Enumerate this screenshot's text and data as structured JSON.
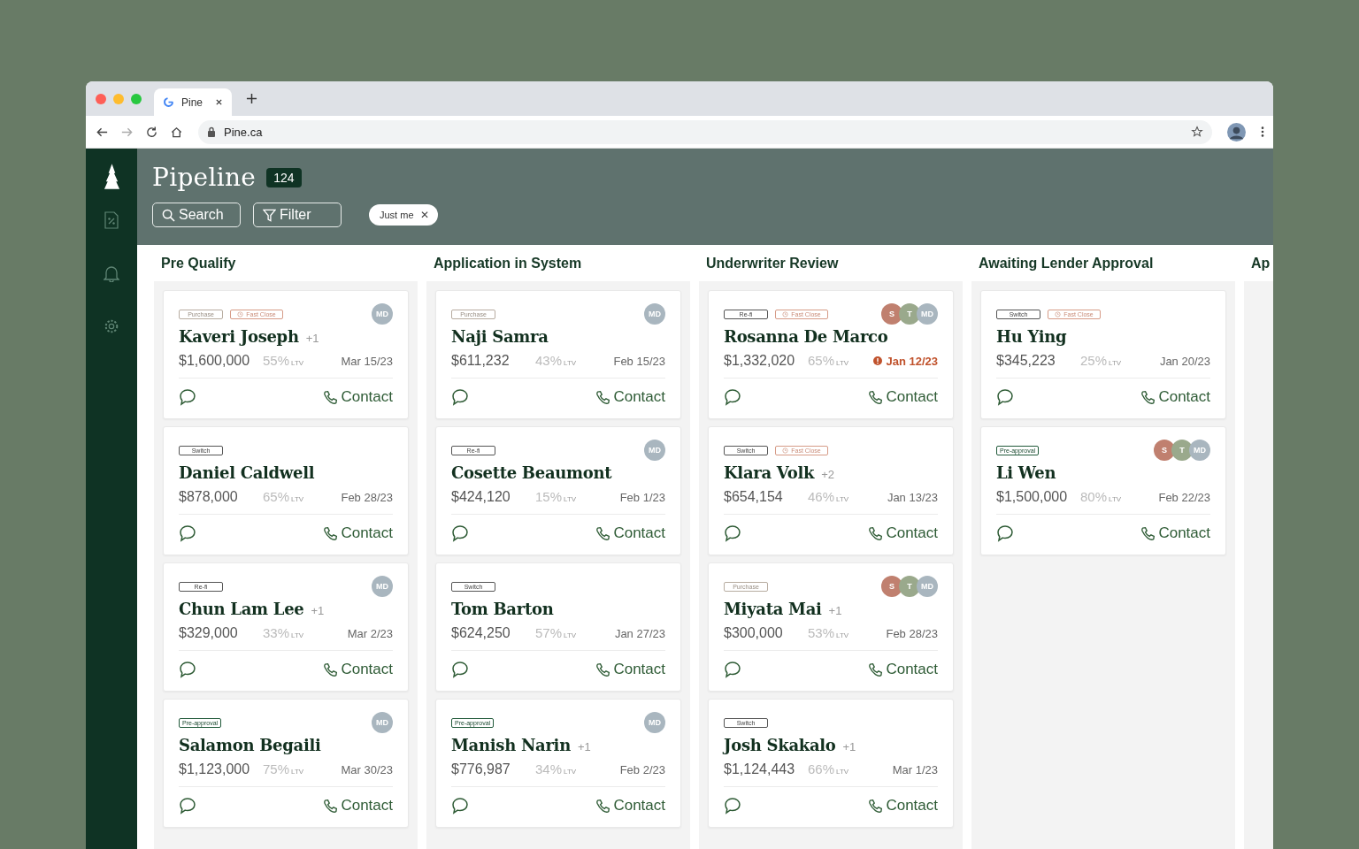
{
  "browser": {
    "tab_title": "Pine",
    "url": "Pine.ca"
  },
  "header": {
    "title": "Pipeline",
    "count": "124",
    "search_label": "Search",
    "filter_label": "Filter",
    "chip": {
      "label": "Just me",
      "close": "✕"
    }
  },
  "columns": [
    {
      "title": "Pre Qualify",
      "cards": [
        {
          "tags": [
            {
              "label": "Purchase",
              "kind": "purchase"
            },
            {
              "label": "Fast Close",
              "kind": "fast"
            }
          ],
          "name": "Kaveri Joseph",
          "extra": "+1",
          "avatars": [
            {
              "initials": "MD",
              "color": "#a9b6bf"
            }
          ],
          "amount": "$1,600,000",
          "ltv": "55%",
          "ltv_label": "LTV",
          "date": "Mar 15/23",
          "overdue": false,
          "action": "Contact"
        },
        {
          "tags": [
            {
              "label": "Switch",
              "kind": "plain"
            }
          ],
          "name": "Daniel Caldwell",
          "amount": "$878,000",
          "ltv": "65%",
          "ltv_label": "LTV",
          "date": "Feb 28/23",
          "overdue": false,
          "action": "Contact"
        },
        {
          "tags": [
            {
              "label": "Re-fi",
              "kind": "plain"
            }
          ],
          "name": "Chun Lam Lee",
          "extra": "+1",
          "avatars": [
            {
              "initials": "MD",
              "color": "#a9b6bf"
            }
          ],
          "amount": "$329,000",
          "ltv": "33%",
          "ltv_label": "LTV",
          "date": "Mar 2/23",
          "overdue": false,
          "action": "Contact"
        },
        {
          "tags": [
            {
              "label": "Pre-approval",
              "kind": "approval"
            }
          ],
          "name": "Salamon Begaili",
          "avatars": [
            {
              "initials": "MD",
              "color": "#a9b6bf"
            }
          ],
          "amount": "$1,123,000",
          "ltv": "75%",
          "ltv_label": "LTV",
          "date": "Mar 30/23",
          "overdue": false,
          "action": "Contact"
        }
      ]
    },
    {
      "title": "Application in System",
      "cards": [
        {
          "tags": [
            {
              "label": "Purchase",
              "kind": "purchase"
            }
          ],
          "name": "Naji Samra",
          "avatars": [
            {
              "initials": "MD",
              "color": "#a9b6bf"
            }
          ],
          "amount": "$611,232",
          "ltv": "43%",
          "ltv_label": "LTV",
          "date": "Feb 15/23",
          "overdue": false,
          "action": "Contact"
        },
        {
          "tags": [
            {
              "label": "Re-fi",
              "kind": "plain"
            }
          ],
          "name": "Cosette Beaumont",
          "avatars": [
            {
              "initials": "MD",
              "color": "#a9b6bf"
            }
          ],
          "amount": "$424,120",
          "ltv": "15%",
          "ltv_label": "LTV",
          "date": "Feb 1/23",
          "overdue": false,
          "action": "Contact"
        },
        {
          "tags": [
            {
              "label": "Switch",
              "kind": "plain"
            }
          ],
          "name": "Tom Barton",
          "amount": "$624,250",
          "ltv": "57%",
          "ltv_label": "LTV",
          "date": "Jan 27/23",
          "overdue": false,
          "action": "Contact"
        },
        {
          "tags": [
            {
              "label": "Pre-approval",
              "kind": "approval"
            }
          ],
          "name": "Manish Narin",
          "extra": "+1",
          "avatars": [
            {
              "initials": "MD",
              "color": "#a9b6bf"
            }
          ],
          "amount": "$776,987",
          "ltv": "34%",
          "ltv_label": "LTV",
          "date": "Feb 2/23",
          "overdue": false,
          "action": "Contact"
        }
      ]
    },
    {
      "title": "Underwriter Review",
      "cards": [
        {
          "tags": [
            {
              "label": "Re-fi",
              "kind": "plain"
            },
            {
              "label": "Fast Close",
              "kind": "fast"
            }
          ],
          "name": "Rosanna De Marco",
          "avatars": [
            {
              "initials": "S",
              "color": "#c0806f"
            },
            {
              "initials": "T",
              "color": "#9aa98c"
            },
            {
              "initials": "MD",
              "color": "#a9b6bf"
            }
          ],
          "amount": "$1,332,020",
          "ltv": "65%",
          "ltv_label": "LTV",
          "date": "Jan 12/23",
          "overdue": true,
          "action": "Contact"
        },
        {
          "tags": [
            {
              "label": "Switch",
              "kind": "plain"
            },
            {
              "label": "Fast Close",
              "kind": "fast"
            }
          ],
          "name": "Klara Volk",
          "extra": "+2",
          "amount": "$654,154",
          "ltv": "46%",
          "ltv_label": "LTV",
          "date": "Jan 13/23",
          "overdue": false,
          "action": "Contact"
        },
        {
          "tags": [
            {
              "label": "Purchase",
              "kind": "purchase"
            }
          ],
          "name": "Miyata Mai",
          "extra": "+1",
          "avatars": [
            {
              "initials": "S",
              "color": "#c0806f"
            },
            {
              "initials": "T",
              "color": "#9aa98c"
            },
            {
              "initials": "MD",
              "color": "#a9b6bf"
            }
          ],
          "amount": "$300,000",
          "ltv": "53%",
          "ltv_label": "LTV",
          "date": "Feb 28/23",
          "overdue": false,
          "action": "Contact"
        },
        {
          "tags": [
            {
              "label": "Switch",
              "kind": "plain"
            }
          ],
          "name": "Josh Skakalo",
          "extra": "+1",
          "amount": "$1,124,443",
          "ltv": "66%",
          "ltv_label": "LTV",
          "date": "Mar 1/23",
          "overdue": false,
          "action": "Contact"
        }
      ]
    },
    {
      "title": "Awaiting Lender Approval",
      "cards": [
        {
          "tags": [
            {
              "label": "Switch",
              "kind": "plain"
            },
            {
              "label": "Fast Close",
              "kind": "fast"
            }
          ],
          "name": "Hu Ying",
          "amount": "$345,223",
          "ltv": "25%",
          "ltv_label": "LTV",
          "date": "Jan 20/23",
          "overdue": false,
          "action": "Contact"
        },
        {
          "tags": [
            {
              "label": "Pre-approval",
              "kind": "approval"
            }
          ],
          "name": "Li Wen",
          "avatars": [
            {
              "initials": "S",
              "color": "#c0806f"
            },
            {
              "initials": "T",
              "color": "#9aa98c"
            },
            {
              "initials": "MD",
              "color": "#a9b6bf"
            }
          ],
          "amount": "$1,500,000",
          "ltv": "80%",
          "ltv_label": "LTV",
          "date": "Feb 22/23",
          "overdue": false,
          "action": "Contact"
        }
      ]
    },
    {
      "title": "Ap"
    }
  ]
}
